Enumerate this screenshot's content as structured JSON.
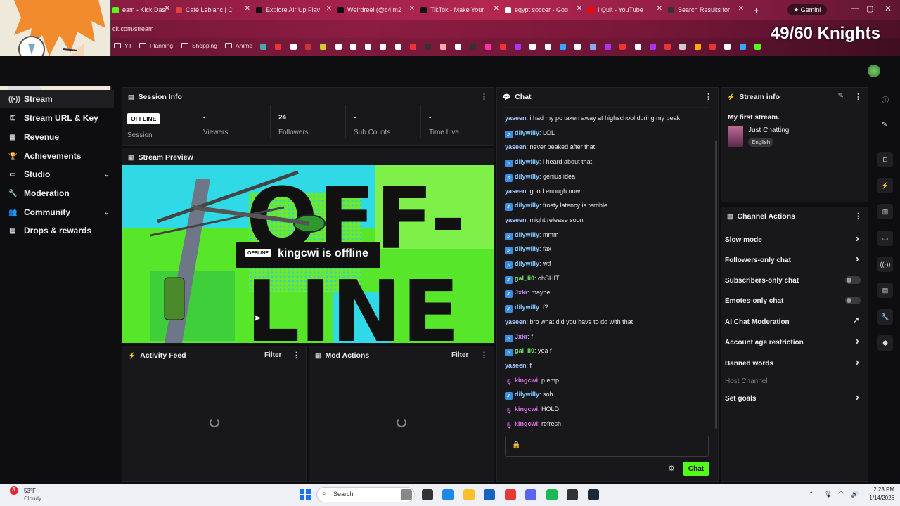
{
  "browser": {
    "tabs": [
      {
        "title": "eam - Kick Dashb",
        "color": "#53fc18"
      },
      {
        "title": "Café Leblanc | C",
        "color": "#e04040"
      },
      {
        "title": "Explore Air Up Flav",
        "color": "#111111"
      },
      {
        "title": "Weirdreel (@c4lm2",
        "color": "#111111"
      },
      {
        "title": "TikTok - Make Your",
        "color": "#111111"
      },
      {
        "title": "egypt soccer - Goo",
        "color": "#ffffff"
      },
      {
        "title": "I Quit - YouTube",
        "color": "#ff0000"
      },
      {
        "title": "Search Results for",
        "color": "#333333"
      }
    ],
    "gemini_label": "Gemini",
    "url": "ck.com/stream",
    "bookmarks": [
      "YT",
      "Planning",
      "Shopping",
      "Anime"
    ]
  },
  "overlay": {
    "knights": "49/60 Knights"
  },
  "sidebar": {
    "items": [
      {
        "label": "Stream",
        "icon": "stream-icon"
      },
      {
        "label": "Stream URL & Key",
        "icon": "key-icon"
      },
      {
        "label": "Revenue",
        "icon": "revenue-icon"
      },
      {
        "label": "Achievements",
        "icon": "trophy-icon"
      },
      {
        "label": "Studio",
        "icon": "studio-icon"
      },
      {
        "label": "Moderation",
        "icon": "wrench-icon"
      },
      {
        "label": "Community",
        "icon": "community-icon"
      },
      {
        "label": "Drops & rewards",
        "icon": "drops-icon"
      }
    ]
  },
  "session": {
    "title": "Session Info",
    "status": "OFFLINE",
    "session_label": "Session",
    "stats": [
      {
        "value": "-",
        "label": "Viewers"
      },
      {
        "value": "24",
        "label": "Followers"
      },
      {
        "value": "-",
        "label": "Sub Counts"
      },
      {
        "value": "-",
        "label": "Time Live"
      }
    ]
  },
  "preview": {
    "title": "Stream Preview",
    "badge": "OFFLINE",
    "message": "kingcwi is offline",
    "art_text_1": "OFF-",
    "art_text_2": "LINE"
  },
  "activity": {
    "title": "Activity Feed",
    "filter": "Filter"
  },
  "mod_actions": {
    "title": "Mod Actions",
    "filter": "Filter"
  },
  "chat": {
    "title": "Chat",
    "button": "Chat",
    "messages": [
      {
        "user": "yaseen",
        "text": "i had my pc taken away at highschool during my peak",
        "color": "#a7c7ff",
        "badge": ""
      },
      {
        "user": "dilywilly",
        "text": "LOL",
        "color": "#7ec8ff",
        "badge": "blue"
      },
      {
        "user": "yaseen",
        "text": "never peaked after that",
        "color": "#a7c7ff",
        "badge": ""
      },
      {
        "user": "dilywilly",
        "text": "i heard about that",
        "color": "#7ec8ff",
        "badge": "blue"
      },
      {
        "user": "dilywilly",
        "text": "genius idea",
        "color": "#7ec8ff",
        "badge": "blue"
      },
      {
        "user": "yaseen",
        "text": "good enough now",
        "color": "#a7c7ff",
        "badge": ""
      },
      {
        "user": "dilywilly",
        "text": "frosty latency is terrible",
        "color": "#7ec8ff",
        "badge": "blue"
      },
      {
        "user": "yaseen",
        "text": "might release soon",
        "color": "#a7c7ff",
        "badge": ""
      },
      {
        "user": "dilywilly",
        "text": "mmm",
        "color": "#7ec8ff",
        "badge": "blue"
      },
      {
        "user": "dilywilly",
        "text": "fax",
        "color": "#7ec8ff",
        "badge": "blue"
      },
      {
        "user": "dilywilly",
        "text": "wtf",
        "color": "#7ec8ff",
        "badge": "blue"
      },
      {
        "user": "gal_li0",
        "text": "ohSHIT",
        "color": "#6fe06f",
        "badge": "blue"
      },
      {
        "user": "Jxkr",
        "text": "maybe",
        "color": "#c58cff",
        "badge": "blue"
      },
      {
        "user": "dilywilly",
        "text": "f?",
        "color": "#7ec8ff",
        "badge": "blue"
      },
      {
        "user": "yaseen",
        "text": "bro what did you have to do with that",
        "color": "#a7c7ff",
        "badge": ""
      },
      {
        "user": "Jxkr",
        "text": "f",
        "color": "#c58cff",
        "badge": "blue"
      },
      {
        "user": "gal_li0",
        "text": "yea f",
        "color": "#6fe06f",
        "badge": "blue"
      },
      {
        "user": "yaseen",
        "text": "f",
        "color": "#a7c7ff",
        "badge": ""
      },
      {
        "user": "kingcwi",
        "text": "p emp",
        "color": "#e06ce8",
        "badge": "mic"
      },
      {
        "user": "dilywilly",
        "text": "sob",
        "color": "#7ec8ff",
        "badge": "blue"
      },
      {
        "user": "kingcwi",
        "text": "HOLD",
        "color": "#e06ce8",
        "badge": "mic"
      },
      {
        "user": "kingcwi",
        "text": "refresh",
        "color": "#e06ce8",
        "badge": "mic"
      }
    ]
  },
  "stream_info": {
    "title": "Stream info",
    "stream_title": "My first stream.",
    "category": "Just Chatting",
    "language": "English"
  },
  "channel_actions": {
    "title": "Channel Actions",
    "items": [
      {
        "label": "Slow mode",
        "control": "chevron"
      },
      {
        "label": "Followers-only chat",
        "control": "chevron"
      },
      {
        "label": "Subscribers-only chat",
        "control": "toggle"
      },
      {
        "label": "Emotes-only chat",
        "control": "toggle"
      },
      {
        "label": "AI Chat Moderation",
        "control": "external"
      },
      {
        "label": "Account age restriction",
        "control": "chevron"
      },
      {
        "label": "Banned words",
        "control": "chevron"
      },
      {
        "label": "Host Channel",
        "control": "none"
      },
      {
        "label": "Set goals",
        "control": "chevron"
      }
    ]
  },
  "taskbar": {
    "temp": "53°F",
    "weather": "Cloudy",
    "search": "Search",
    "time": "2:23 PM",
    "date": "1/14/2026",
    "notif": "3"
  },
  "colors": {
    "accent": "#53fc18"
  }
}
